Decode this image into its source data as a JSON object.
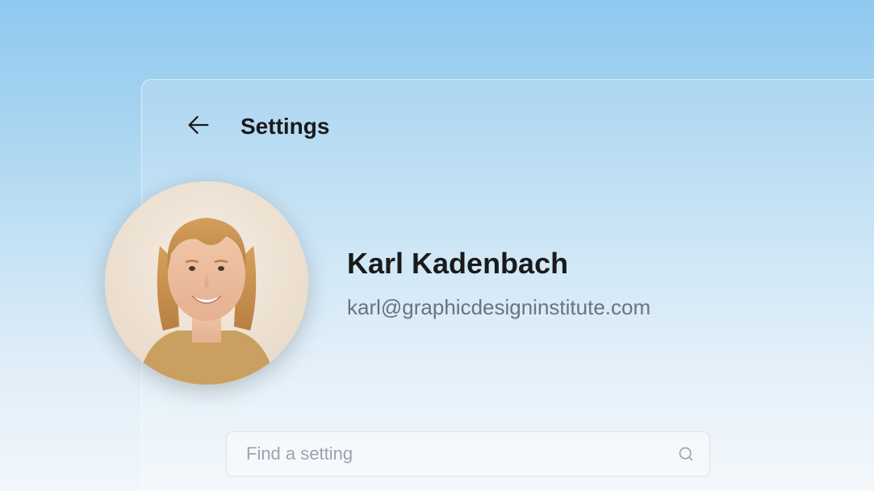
{
  "header": {
    "title": "Settings"
  },
  "profile": {
    "name": "Karl Kadenbach",
    "email": "karl@graphicdesigninstitute.com"
  },
  "search": {
    "placeholder": "Find a setting"
  }
}
